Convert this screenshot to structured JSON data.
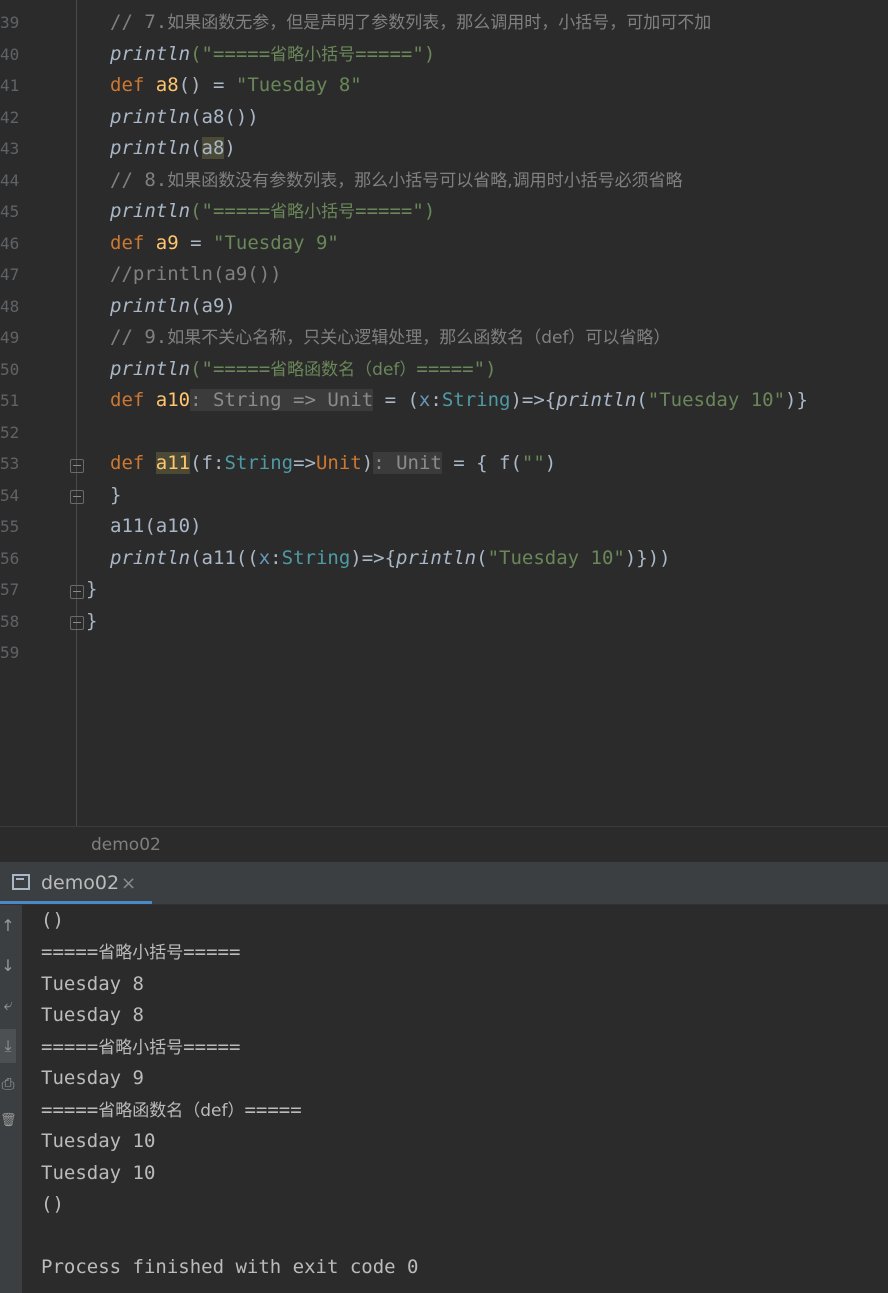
{
  "editor": {
    "line_numbers": [
      "39",
      "40",
      "41",
      "42",
      "43",
      "44",
      "45",
      "46",
      "47",
      "48",
      "49",
      "50",
      "51",
      "52",
      "53",
      "54",
      "55",
      "56",
      "57",
      "58",
      "59"
    ],
    "line39": {
      "prefix": "// 7.",
      "text": "如果函数无参，但是声明了参数列表，那么调用时，小括号，可加可不加"
    },
    "line40": {
      "fn": "println",
      "open": "(\"",
      "eq1": "=====",
      "zh": "省略小括号",
      "eq2": "=====",
      "close": "\")"
    },
    "line41": {
      "kw": "def",
      "name": "a8",
      "mid": "() = ",
      "str": "\"Tuesday 8\""
    },
    "line42": {
      "fn": "println",
      "rest": "(a8())"
    },
    "line43": {
      "fn": "println",
      "open": "(",
      "arg": "a8",
      "close": ")"
    },
    "line44": {
      "prefix": "// 8.",
      "text": "如果函数没有参数列表，那么小括号可以省略,调用时小括号必须省略"
    },
    "line45": {
      "fn": "println",
      "open": "(\"",
      "eq1": "=====",
      "zh": "省略小括号",
      "eq2": "=====",
      "close": "\")"
    },
    "line46": {
      "kw": "def",
      "name": "a9",
      "mid": " = ",
      "str": "\"Tuesday 9\""
    },
    "line47": {
      "text": "//println(a9())"
    },
    "line48": {
      "fn": "println",
      "rest": "(a9)"
    },
    "line49": {
      "prefix": "// 9.",
      "text": "如果不关心名称，只关心逻辑处理，那么函数名（def）可以省略）"
    },
    "line50": {
      "fn": "println",
      "open": "(\"",
      "eq1": "=====",
      "zh": "省略函数名（def）",
      "eq2": "=====",
      "close": "\")"
    },
    "line51": {
      "kw": "def",
      "name": "a10",
      "hint": ": String => Unit",
      "eq": " = (",
      "param": "x",
      "colon": ":",
      "type": "String",
      "arrow": ")=>{",
      "fn": "println",
      "p1": "(",
      "str": "\"Tuesday 10\"",
      "p2": ")}"
    },
    "line53": {
      "kw": "def",
      "name": "a11",
      "p1": "(f:",
      "type1": "String",
      "arrow": "=>",
      "type2": "Unit",
      "p2": ")",
      "hint": ": Unit",
      "eq": " = { f(",
      "str": "\"\"",
      "close": ")"
    },
    "line54": {
      "text": "}"
    },
    "line55": {
      "text": "a11(a10)"
    },
    "line56": {
      "fn": "println",
      "p1": "(a11((",
      "param": "x",
      "colon": ":",
      "type": "String",
      "arrow": ")=>{",
      "fn2": "println",
      "p2": "(",
      "str": "\"Tuesday 10\"",
      "p3": ")}))"
    },
    "line57": {
      "text": "}"
    },
    "line58": {
      "text": "}"
    }
  },
  "breadcrumb": {
    "label": "demo02"
  },
  "run_panel": {
    "tab_label": "demo02",
    "tab_close": "×",
    "sidebar_icons": [
      "↑",
      "↓",
      "⤶",
      "⤓",
      "⎙",
      "🗑"
    ],
    "output": {
      "o1": "()",
      "o2a": "=====",
      "o2b": "省略小括号",
      "o2c": "=====",
      "o3": "Tuesday 8",
      "o4": "Tuesday 8",
      "o5a": "=====",
      "o5b": "省略小括号",
      "o5c": "=====",
      "o6": "Tuesday 9",
      "o7a": "=====",
      "o7b": "省略函数名（def）",
      "o7c": "=====",
      "o8": "Tuesday 10",
      "o9": "Tuesday 10",
      "o10": "()",
      "o12": "Process finished with exit code 0"
    }
  }
}
